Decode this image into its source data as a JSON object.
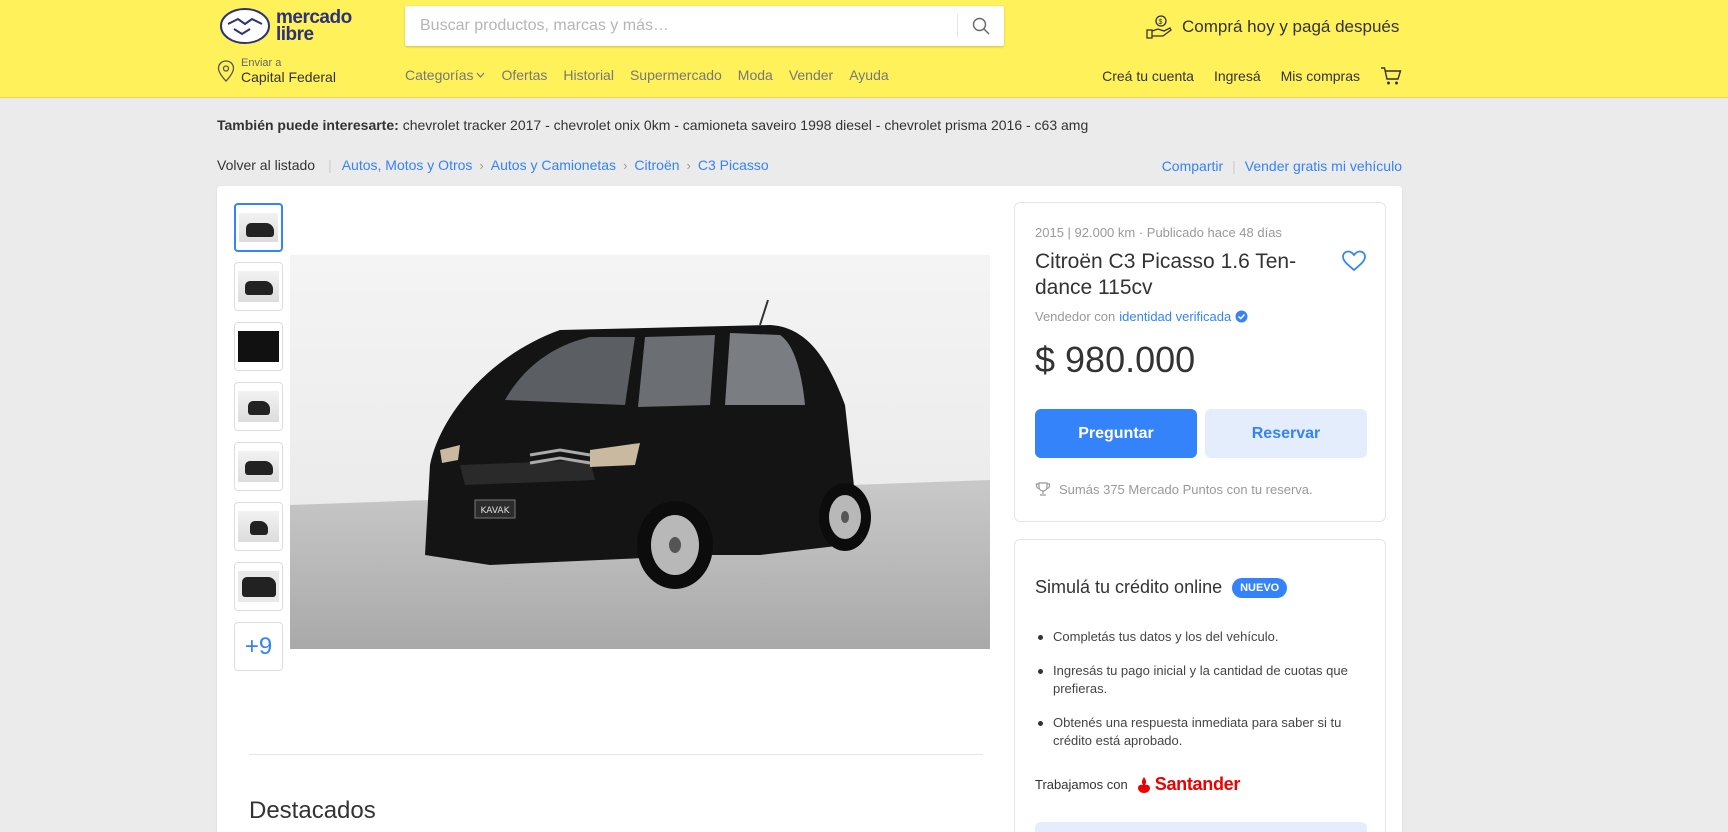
{
  "header": {
    "logo_text_1": "mercado",
    "logo_text_2": "libre",
    "search_placeholder": "Buscar productos, marcas y más…",
    "promo": "Comprá hoy y pagá después",
    "location_label": "Enviar a",
    "location_value": "Capital Federal",
    "nav": [
      "Categorías",
      "Ofertas",
      "Historial",
      "Supermercado",
      "Moda",
      "Vender",
      "Ayuda"
    ],
    "user_nav": [
      "Creá tu cuenta",
      "Ingresá",
      "Mis compras"
    ]
  },
  "interest": {
    "label": "También puede interesarte:",
    "items": "chevrolet tracker 2017 - chevrolet onix 0km - camioneta saveiro 1998 diesel - chevrolet prisma 2016 - c63 amg"
  },
  "breadcrumb": {
    "back": "Volver al listado",
    "items": [
      "Autos, Motos y Otros",
      "Autos y Camionetas",
      "Citroën",
      "C3 Picasso"
    ],
    "share": "Compartir",
    "sell": "Vender gratis mi vehículo"
  },
  "gallery": {
    "more": "+9",
    "plate": "KAVAK"
  },
  "listing": {
    "subtitle": "2015 | 92.000 km · Publicado hace 48 días",
    "title": "Citroën C3 Picasso 1.6 Ten-dance 115cv",
    "seller_prefix": "Vendedor con",
    "seller_link": "identidad verificada",
    "price": "$ 980.000",
    "ask_button": "Preguntar",
    "reserve_button": "Reservar",
    "points": "Sumás 375 Mercado Puntos con tu reserva."
  },
  "credit": {
    "title": "Simulá tu crédito online",
    "badge": "NUEVO",
    "bullets": [
      "Completás tus datos y los del vehículo.",
      "Ingresás tu pago inicial y la cantidad de cuotas que prefieras.",
      "Obtenés una respuesta inmediata para saber si tu crédito está aprobado."
    ],
    "partner_label": "Trabajamos con",
    "partner_name": "Santander"
  },
  "section": {
    "destacados": "Destacados"
  },
  "colors": {
    "brand_yellow": "#fff159",
    "accent_blue": "#3483fa",
    "santander_red": "#ec0000"
  }
}
